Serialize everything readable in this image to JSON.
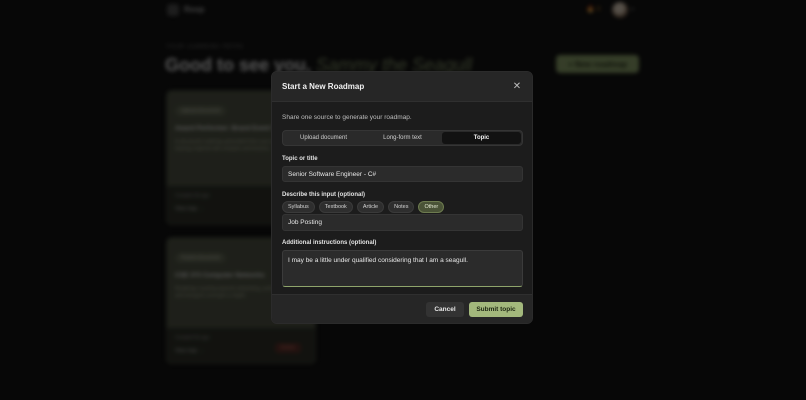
{
  "app": {
    "logo_text": "Roop",
    "streak_text": "🔥 0",
    "kicker": "YOUR LEARNING PATHS",
    "greeting_prefix": "Good to see you, ",
    "greeting_name": "Sammy the Seagull",
    "new_roadmap_label": "+ New roadmap"
  },
  "background_cards": [
    {
      "chip": "Upload document",
      "title": "Award Performer: Brand Event Training",
      "desc": "A structured roadmap generated from your uploaded training material with modules and lessons.",
      "meta": "Created 3d ago",
      "view": "View map →",
      "tag": ""
    },
    {
      "chip": "Pasted document",
      "title": "CSE 373 Computer Networks",
      "desc": "Roadmap covering layered networking, protocols, routing and transport concepts in depth.",
      "meta": "Created 5d ago",
      "view": "View map →",
      "tag": "Delete"
    }
  ],
  "modal": {
    "title": "Start a New Roadmap",
    "subtitle": "Share one source to generate your roadmap.",
    "tabs": [
      {
        "label": "Upload document",
        "active": false
      },
      {
        "label": "Long-form text",
        "active": false
      },
      {
        "label": "Topic",
        "active": true
      }
    ],
    "topic_label": "Topic or title",
    "topic_value": "Senior Software Engineer - C#",
    "describe_label": "Describe this input (optional)",
    "chips": [
      {
        "label": "Syllabus",
        "active": false
      },
      {
        "label": "Textbook",
        "active": false
      },
      {
        "label": "Article",
        "active": false
      },
      {
        "label": "Notes",
        "active": false
      },
      {
        "label": "Other",
        "active": true
      }
    ],
    "describe_value": "Job Posting",
    "instructions_label": "Additional instructions (optional)",
    "instructions_value": "I may be a little under qualified considering that I am a seagull.",
    "cancel_label": "Cancel",
    "submit_label": "Submit topic",
    "close_glyph": "✕"
  },
  "colors": {
    "accent": "#a3b87c",
    "active_chip": "#4a5337",
    "modal_bg": "#1c1c1c"
  }
}
